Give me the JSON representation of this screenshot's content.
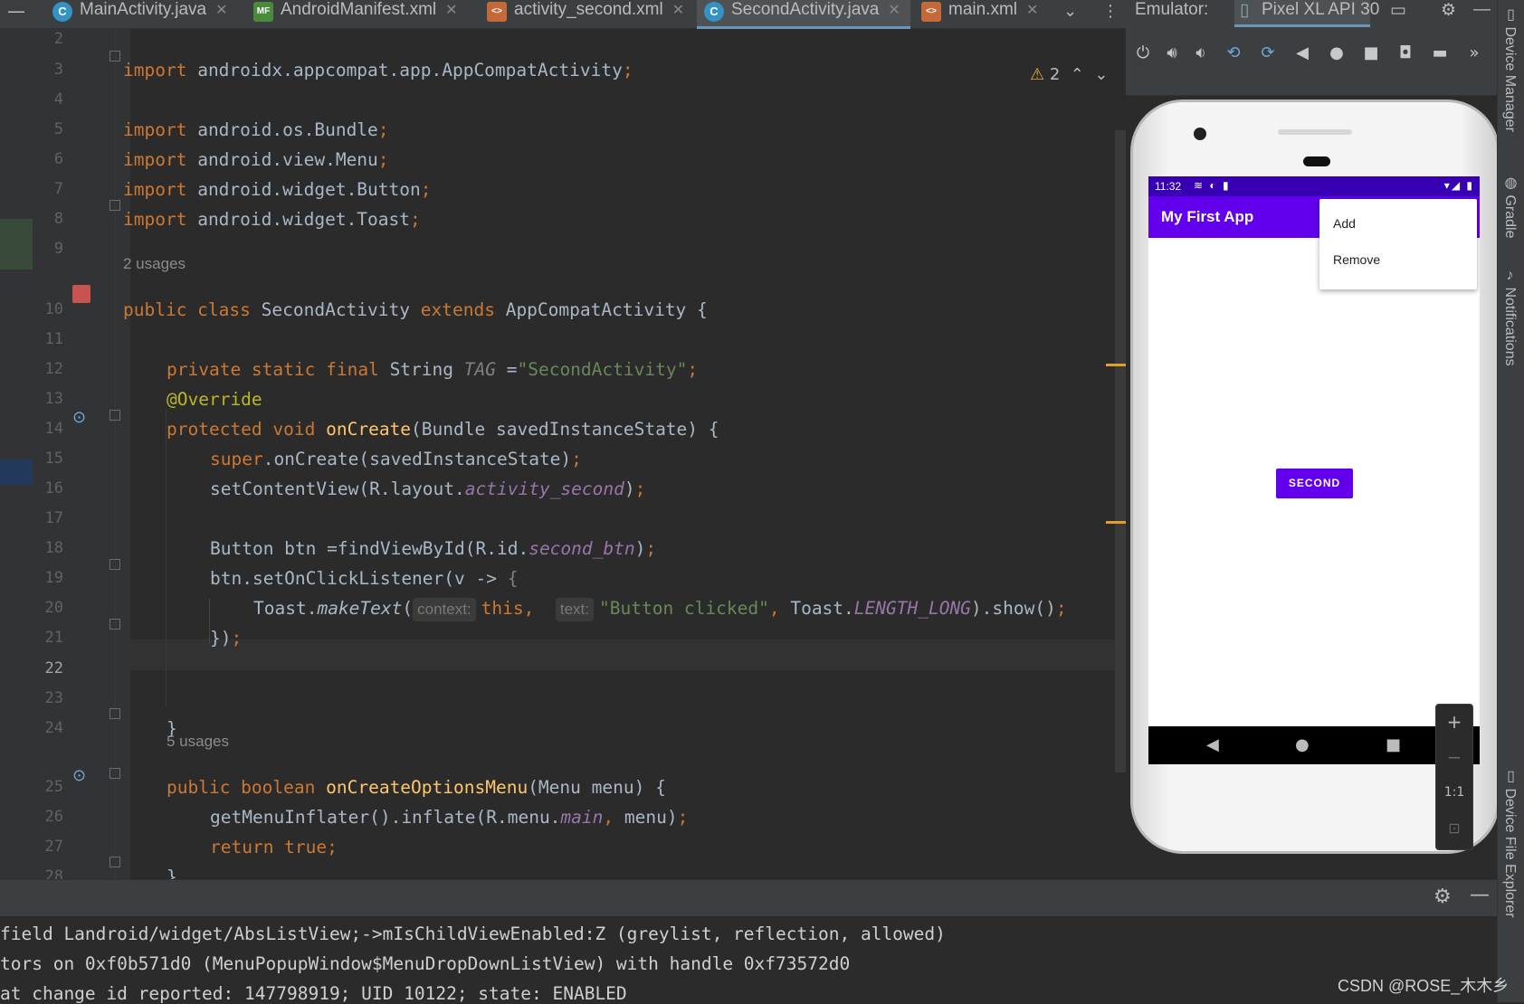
{
  "tabs": [
    {
      "label": "MainActivity.java",
      "icon": "C"
    },
    {
      "label": "AndroidManifest.xml",
      "icon": "MF"
    },
    {
      "label": "activity_second.xml",
      "icon": "xml"
    },
    {
      "label": "SecondActivity.java",
      "icon": "C",
      "active": true
    },
    {
      "label": "main.xml",
      "icon": "xml"
    }
  ],
  "editor": {
    "warnings": "2",
    "line_numbers": [
      "2",
      "3",
      "4",
      "5",
      "6",
      "7",
      "8",
      "9",
      "10",
      "11",
      "12",
      "13",
      "14",
      "15",
      "16",
      "17",
      "18",
      "19",
      "20",
      "21",
      "22",
      "23",
      "24",
      "25",
      "26",
      "27",
      "28"
    ],
    "usages_1": "2 usages",
    "usages_2": "5 usages",
    "l3": [
      "import",
      "androidx.appcompat.app.AppCompatActivity",
      ";"
    ],
    "l5": [
      "import",
      "android.os.Bundle",
      ";"
    ],
    "l6": [
      "import",
      "android.view.Menu",
      ";"
    ],
    "l7": [
      "import",
      "android.widget.Button",
      ";"
    ],
    "l8": [
      "import",
      "android.widget.Toast",
      ";"
    ],
    "l10": [
      "public class",
      "SecondActivity",
      "extends",
      "AppCompatActivity {"
    ],
    "l12": [
      "private static final",
      "String",
      "TAG",
      " =",
      "\"SecondActivity\"",
      ";"
    ],
    "l13": "@Override",
    "l14": [
      "protected void",
      "onCreate",
      "(Bundle savedInstanceState) {"
    ],
    "l15": [
      "super",
      ".onCreate(savedInstanceState)",
      ";"
    ],
    "l16": [
      "setContentView(R.layout.",
      "activity_second",
      ")",
      ";"
    ],
    "l18": [
      "Button btn =findViewById(R.id.",
      "second_btn",
      ")",
      ";"
    ],
    "l19": [
      "btn.setOnClickListener(v -> ",
      "{"
    ],
    "l20": [
      "Toast.",
      "makeText",
      "(",
      "context:",
      "this",
      ",",
      "text:",
      "\"Button clicked\"",
      ",",
      " Toast.",
      "LENGTH_LONG",
      ").show()",
      ";"
    ],
    "l21": [
      "})",
      ";"
    ],
    "l24": "}",
    "l25": [
      "public boolean",
      "onCreateOptionsMenu",
      "(Menu menu) {"
    ],
    "l26": [
      "getMenuInflater().inflate(R.menu.",
      "main",
      ",",
      " menu)",
      ";"
    ],
    "l27": [
      "return true",
      ";"
    ],
    "l28": "}"
  },
  "emulator": {
    "label": "Emulator:",
    "device": "Pixel XL API 30",
    "time": "11:32",
    "app_title": "My First App",
    "menu_items": [
      "Add",
      "Remove"
    ],
    "button_label": "SECOND",
    "zoom": {
      "plus": "+",
      "minus": "−",
      "one_to_one": "1:1"
    }
  },
  "side_tools": [
    "Device Manager",
    "Gradle",
    "Notifications",
    "Device File Explorer"
  ],
  "log": [
    "field Landroid/widget/AbsListView;->mIsChildViewEnabled:Z (greylist, reflection, allowed)",
    "tors on 0xf0b571d0 (MenuPopupWindow$MenuDropDownListView) with handle 0xf73572d0",
    "at change id reported: 147798919; UID 10122; state: ENABLED"
  ],
  "watermark": "CSDN @ROSE_木木乡"
}
